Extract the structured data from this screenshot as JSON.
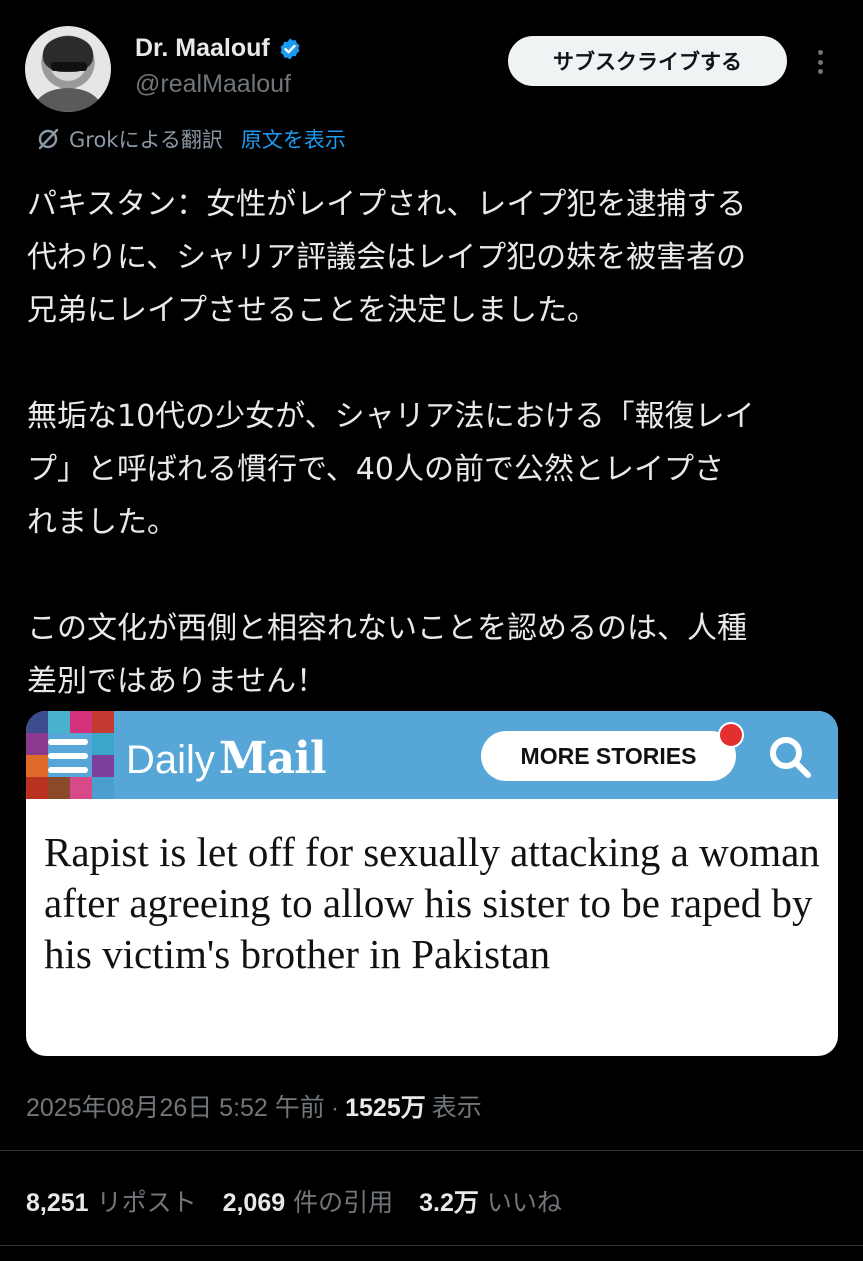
{
  "author": {
    "display_name": "Dr. Maalouf",
    "handle": "@realMaalouf",
    "verified_color": "#1d9bf0"
  },
  "subscribe_label": "サブスクライブする",
  "translation": {
    "label": "Grokによる翻訳",
    "show_original": "原文を表示"
  },
  "tweet": {
    "text": "パキスタン：女性がレイプされ、レイプ犯を逮捕する\n代わりに、シャリア評議会はレイプ犯の妹を被害者の\n兄弟にレイプさせることを決定しました。\n\n無垢な10代の少女が、シャリア法における「報復レイ\nプ」と呼ばれる慣行で、40人の前で公然とレイプさ\nれました。\n\nこの文化が西側と相容れないことを認めるのは、人種\n差別ではありません！"
  },
  "card": {
    "brand_daily": "Daily",
    "brand_mail": "Mail",
    "more_stories": "MORE STORIES",
    "headline": "Rapist is let off for sexually attacking a woman after agreeing to allow his sister to be raped by his victim's brother in Pakistan",
    "bar_color": "#56a7d7"
  },
  "meta": {
    "timestamp": "2025年08月26日 5:52 午前",
    "separator": "·",
    "views": "1525万",
    "views_label": "表示"
  },
  "stats": {
    "reposts": "8,251",
    "reposts_label": "リポスト",
    "quotes": "2,069",
    "quotes_label": "件の引用",
    "likes": "3.2万",
    "likes_label": "いいね"
  }
}
